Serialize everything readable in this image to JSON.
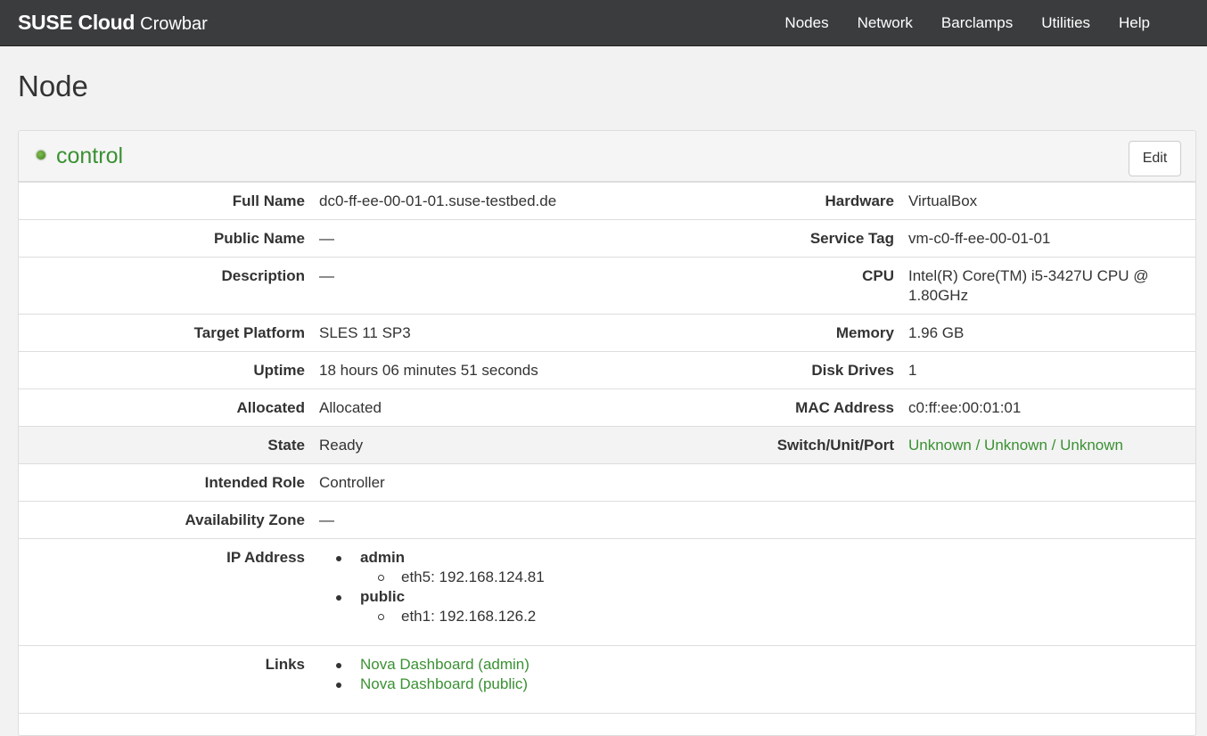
{
  "brand": {
    "main": "SUSE Cloud",
    "sub": "Crowbar"
  },
  "nav": [
    "Nodes",
    "Network",
    "Barclamps",
    "Utilities",
    "Help"
  ],
  "page_title": "Node",
  "node": {
    "name": "control",
    "status_color": "#4a8f2a",
    "edit_label": "Edit"
  },
  "rows": {
    "full_name": {
      "label": "Full Name",
      "value": "dc0-ff-ee-00-01-01.suse-testbed.de"
    },
    "hardware": {
      "label": "Hardware",
      "value": "VirtualBox"
    },
    "public_name": {
      "label": "Public Name",
      "value": "—"
    },
    "service_tag": {
      "label": "Service Tag",
      "value": "vm-c0-ff-ee-00-01-01"
    },
    "description": {
      "label": "Description",
      "value": "—"
    },
    "cpu": {
      "label": "CPU",
      "value": "Intel(R) Core(TM) i5-3427U CPU @ 1.80GHz"
    },
    "target_platform": {
      "label": "Target Platform",
      "value": "SLES 11 SP3"
    },
    "memory": {
      "label": "Memory",
      "value": "1.96 GB"
    },
    "uptime": {
      "label": "Uptime",
      "value": "18 hours 06 minutes 51 seconds"
    },
    "disk_drives": {
      "label": "Disk Drives",
      "value": "1"
    },
    "allocated": {
      "label": "Allocated",
      "value": "Allocated"
    },
    "mac_address": {
      "label": "MAC Address",
      "value": "c0:ff:ee:00:01:01"
    },
    "state": {
      "label": "State",
      "value": "Ready"
    },
    "switch": {
      "label": "Switch/Unit/Port",
      "value": "Unknown / Unknown / Unknown"
    },
    "intended_role": {
      "label": "Intended Role",
      "value": "Controller"
    },
    "availability_zone": {
      "label": "Availability Zone",
      "value": "—"
    },
    "ip_address": {
      "label": "IP Address",
      "networks": [
        {
          "name": "admin",
          "entry": "eth5: 192.168.124.81"
        },
        {
          "name": "public",
          "entry": "eth1: 192.168.126.2"
        }
      ]
    },
    "links": {
      "label": "Links",
      "items": [
        "Nova Dashboard (admin)",
        "Nova Dashboard (public)"
      ]
    }
  },
  "colors": {
    "accent_green": "#3a9133",
    "navbar": "#3a3c3e"
  }
}
